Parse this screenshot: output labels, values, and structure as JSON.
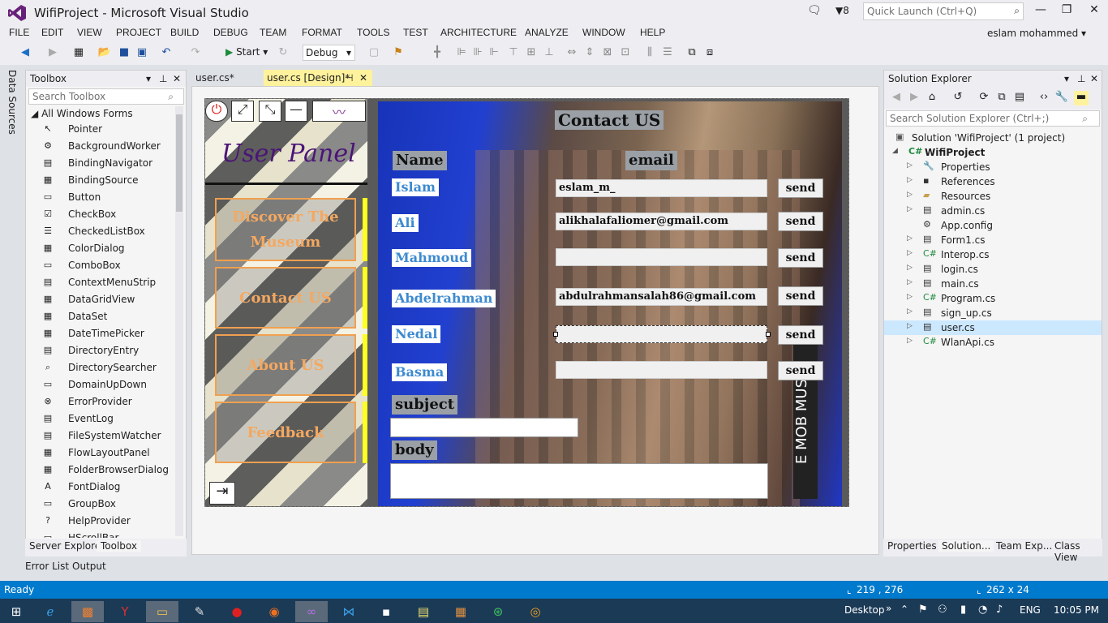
{
  "window": {
    "title": "WifiProject - Microsoft Visual Studio",
    "notification_count": "8",
    "quick_launch_placeholder": "Quick Launch (Ctrl+Q)",
    "user": "eslam mohammed"
  },
  "menu": [
    "FILE",
    "EDIT",
    "VIEW",
    "PROJECT",
    "BUILD",
    "DEBUG",
    "TEAM",
    "FORMAT",
    "TOOLS",
    "TEST",
    "ARCHITECTURE",
    "ANALYZE",
    "WINDOW",
    "HELP"
  ],
  "toolbar": {
    "start_label": "Start",
    "config": "Debug"
  },
  "left_strip": {
    "data_sources": "Data Sources"
  },
  "toolbox": {
    "title": "Toolbox",
    "search_placeholder": "Search Toolbox",
    "group": "All Windows Forms",
    "items": [
      "Pointer",
      "BackgroundWorker",
      "BindingNavigator",
      "BindingSource",
      "Button",
      "CheckBox",
      "CheckedListBox",
      "ColorDialog",
      "ComboBox",
      "ContextMenuStrip",
      "DataGridView",
      "DataSet",
      "DateTimePicker",
      "DirectoryEntry",
      "DirectorySearcher",
      "DomainUpDown",
      "ErrorProvider",
      "EventLog",
      "FileSystemWatcher",
      "FlowLayoutPanel",
      "FolderBrowserDialog",
      "FontDialog",
      "GroupBox",
      "HelpProvider",
      "HScrollBar"
    ],
    "tabs": [
      "Server Explorer",
      "Toolbox"
    ]
  },
  "doc_tabs": [
    "user.cs*",
    "user.cs [Design]*"
  ],
  "form": {
    "panel_title": "User Panel",
    "nav": [
      "Discover The Museum",
      "Contact US",
      "About US",
      "Feedback"
    ],
    "contact_title": "Contact US",
    "name_header": "Name",
    "email_header": "email",
    "rows": [
      {
        "name": "Islam",
        "email": "eslam_m_"
      },
      {
        "name": "Ali",
        "email": "alikhalafaliomer@gmail.com"
      },
      {
        "name": "Mahmoud",
        "email": ""
      },
      {
        "name": "Abdelrahman",
        "email": "abdulrahmansalah86@gmail.com"
      },
      {
        "name": "Nedal",
        "email": ""
      },
      {
        "name": "Basma",
        "email": ""
      }
    ],
    "send_label": "send",
    "subject_label": "subject",
    "body_label": "body",
    "building_text": "E MOB MUS"
  },
  "solution_explorer": {
    "title": "Solution Explorer",
    "search_placeholder": "Search Solution Explorer (Ctrl+;)",
    "solution": "Solution 'WifiProject' (1 project)",
    "project": "WifiProject",
    "items": [
      "Properties",
      "References",
      "Resources",
      "admin.cs",
      "App.config",
      "Form1.cs",
      "Interop.cs",
      "login.cs",
      "main.cs",
      "Program.cs",
      "sign_up.cs",
      "user.cs",
      "WlanApi.cs"
    ],
    "tabs": [
      "Properties",
      "Solution...",
      "Team Exp...",
      "Class View"
    ]
  },
  "bottom_tabs": [
    "Error List",
    "Output"
  ],
  "status": {
    "text": "Ready",
    "position": "219 , 276",
    "size": "262 x 24"
  },
  "taskbar": {
    "desktop": "Desktop",
    "lang": "ENG",
    "time": "10:05 PM"
  }
}
